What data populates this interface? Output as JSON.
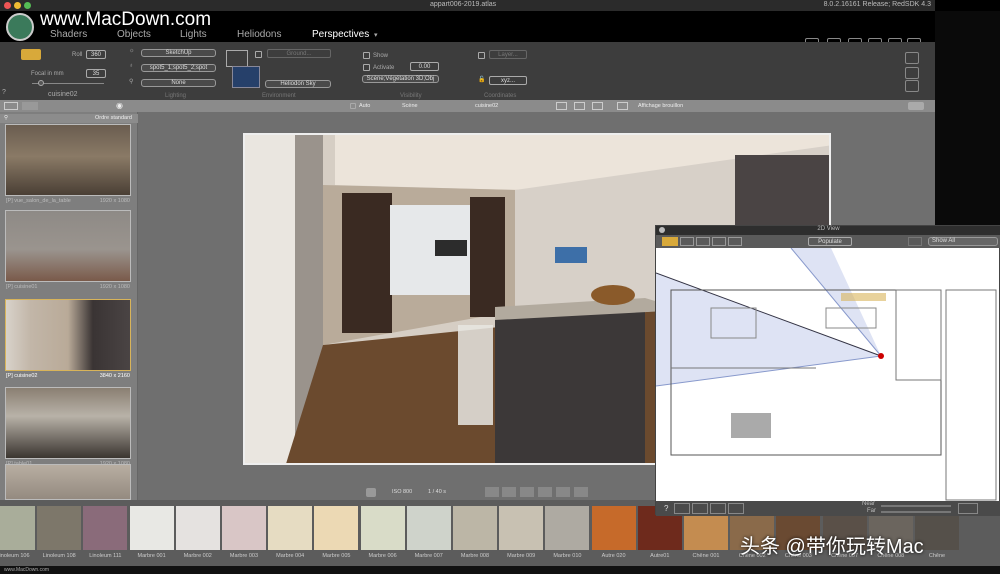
{
  "window": {
    "title": "appart006-2019.atlas",
    "version": "8.0.2.16161 Release; RedSDK 4.3"
  },
  "watermark": {
    "site": "www.MacDown.com",
    "footer": "www.MacDown.com",
    "bottom_right": "头条 @带你玩转Mac"
  },
  "menu": {
    "tabs": [
      "Shaders",
      "Objects",
      "Lights",
      "Heliodons",
      "Perspectives"
    ],
    "active": "Perspectives"
  },
  "toolbar": {
    "roll_label": "Roll",
    "roll_value": "360",
    "focal_label": "Focal in mm",
    "focal_value": "35",
    "camera_name": "cuisine02",
    "help": "?",
    "lighting": {
      "label": "Lighting",
      "preset": "SketchUp",
      "lights": "spot5_1;spot5_2;spot",
      "third": "None"
    },
    "environment": {
      "label": "Environment",
      "ground": "Ground...",
      "sky": "Heliodon Sky"
    },
    "visibility": {
      "label": "Visibility",
      "show": "Show",
      "activate": "Activate",
      "value": "0.00",
      "layers": "Scène;Végétation 3D;Obj"
    },
    "coordinates": {
      "label": "Coordinates",
      "layer": "Layer...",
      "xyz": "xyz..."
    }
  },
  "subbar": {
    "auto": "Auto",
    "scene": "Scène",
    "camera": "cuisine02",
    "draft": "Affichage brouillon"
  },
  "perspectives": {
    "sort": "Ordre standard",
    "items": [
      {
        "name": "[P] vue_salon_de_la_table",
        "size": "1920 x 1080"
      },
      {
        "name": "[P] cuisine01",
        "size": "1920 x 1080"
      },
      {
        "name": "[P] cuisine02",
        "size": "3840 x 2160",
        "selected": true
      },
      {
        "name": "[P] table01",
        "size": "1920 x 1080"
      },
      {
        "name": "",
        "size": ""
      }
    ]
  },
  "viewport_bar": {
    "iso": "ISO 800",
    "exposure": "1 / 40 s"
  },
  "view2d": {
    "title": "2D View",
    "populate": "Populate",
    "filter": "Show All",
    "help": "?",
    "near": "Near",
    "far": "Far"
  },
  "materials": [
    "Linoleum 106",
    "Linoleum 108",
    "Linoleum 111",
    "Marbre 001",
    "Marbre 002",
    "Marbre 003",
    "Marbre 004",
    "Marbre 005",
    "Marbre 006",
    "Marbre 007",
    "Marbre 008",
    "Marbre 009",
    "Marbre 010",
    "Autre 020",
    "Autre01",
    "Chêne 001",
    "Chêne 002",
    "Chêne 003",
    "Chêne 007",
    "Chêne 008",
    "Chêne"
  ],
  "material_colors": [
    "#a9ad9a",
    "#7d776a",
    "#8a6b7a",
    "#e8e8e4",
    "#e5e2e0",
    "#d9c6c6",
    "#e6dcc2",
    "#ecd9b4",
    "#d9dcc8",
    "#cfd3cb",
    "#bcb6a6",
    "#c8c1b2",
    "#aeaaa2",
    "#c66a2a",
    "#6e2a1c",
    "#c48c50",
    "#8a6a4a",
    "#6a4a32",
    "#5a5048",
    "#6b655e",
    "#55504a"
  ]
}
